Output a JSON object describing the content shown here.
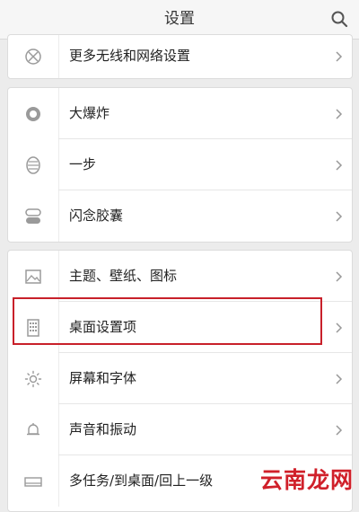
{
  "header": {
    "title": "设置"
  },
  "groups": [
    {
      "items": [
        {
          "label": "更多无线和网络设置",
          "icon": "wireless-x-icon"
        }
      ]
    },
    {
      "items": [
        {
          "label": "大爆炸",
          "icon": "big-bang-icon"
        },
        {
          "label": "一步",
          "icon": "one-step-icon"
        },
        {
          "label": "闪念胶囊",
          "icon": "capsule-icon"
        }
      ]
    },
    {
      "items": [
        {
          "label": "主题、壁纸、图标",
          "icon": "theme-image-icon"
        },
        {
          "label": "桌面设置项",
          "icon": "desktop-grid-icon"
        },
        {
          "label": "屏幕和字体",
          "icon": "brightness-icon"
        },
        {
          "label": "声音和振动",
          "icon": "bell-icon"
        },
        {
          "label": "多任务/到桌面/回上一级",
          "icon": "multitask-icon"
        }
      ]
    }
  ],
  "highlight_color": "#c8202a",
  "watermark": "云南龙网"
}
